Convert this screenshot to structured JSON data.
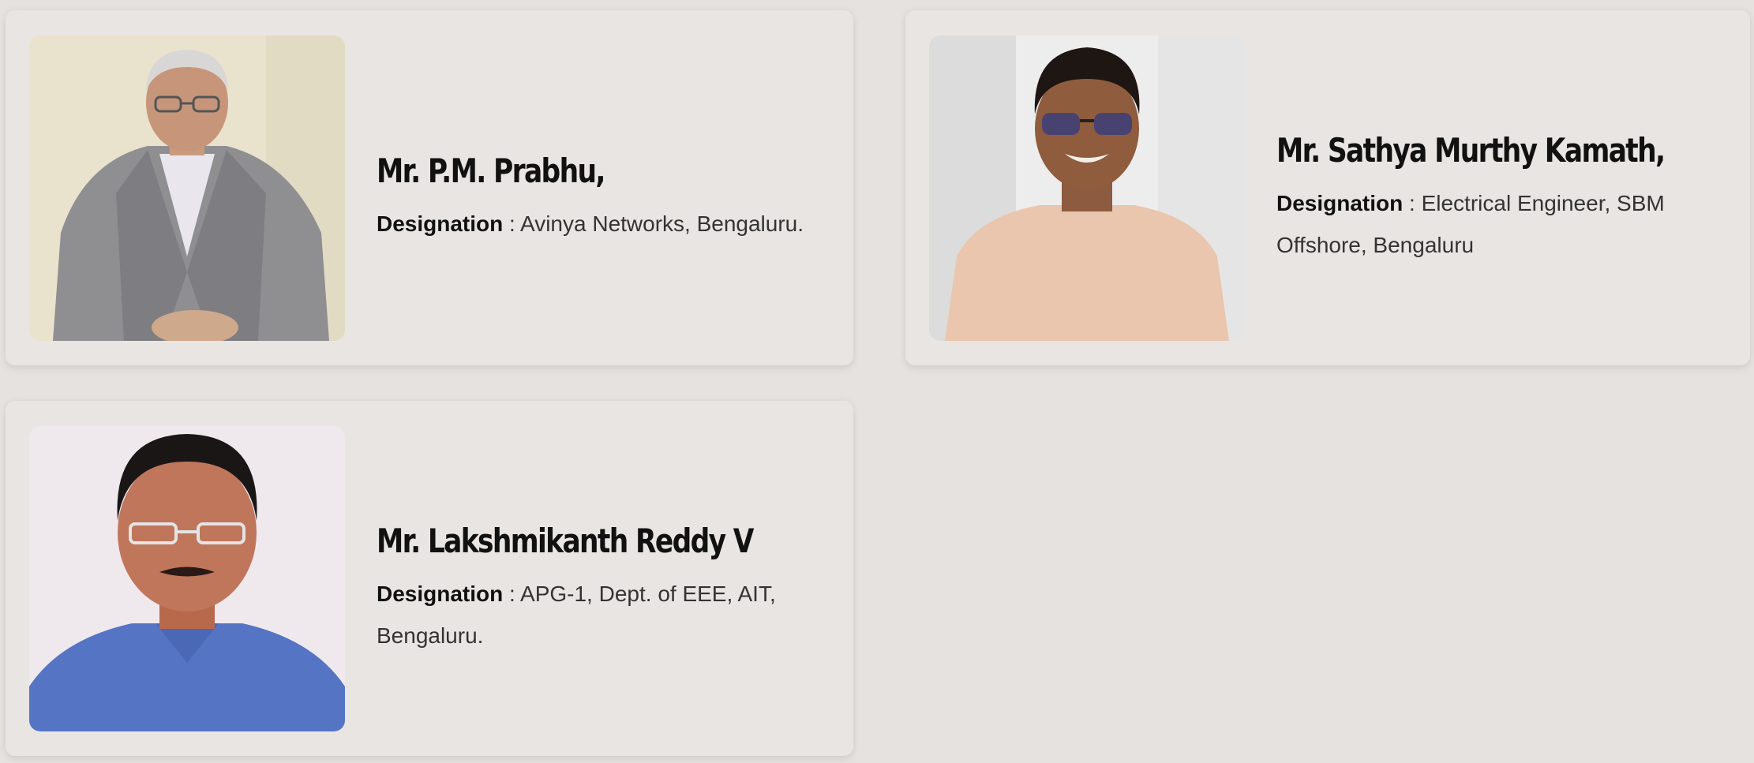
{
  "people": [
    {
      "name": "Mr. P.M. Prabhu,",
      "designation_label": "Designation",
      "designation_value": ": Avinya Networks, Bengaluru."
    },
    {
      "name": "Mr. Sathya Murthy Kamath,",
      "designation_label": "Designation",
      "designation_value": ": Electrical Engineer, SBM Offshore, Bengaluru"
    },
    {
      "name": "Mr. Lakshmikanth Reddy V",
      "designation_label": "Designation",
      "designation_value": ": APG-1, Dept. of EEE, AIT, Bengaluru."
    }
  ],
  "colors": {
    "page_background": "#e6e2df",
    "card_background": "#e9e5e2",
    "name_text": "#111111",
    "body_text": "#333333"
  }
}
